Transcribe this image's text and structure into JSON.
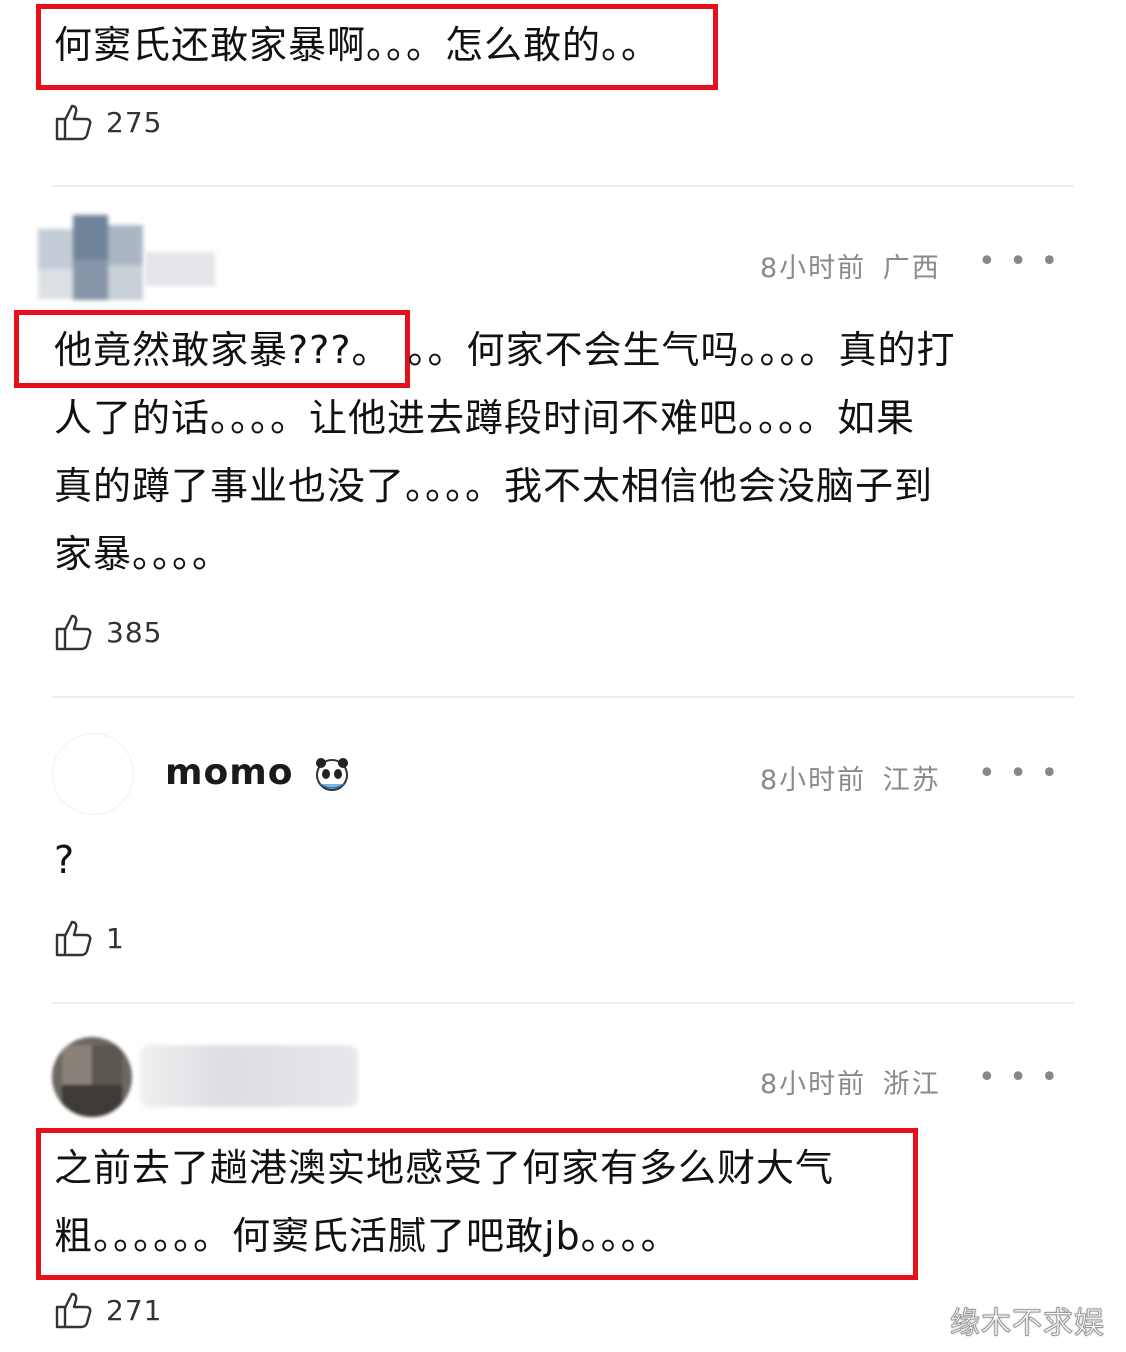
{
  "comments": [
    {
      "text": "何窦氏还敢家暴啊。。。怎么敢的。。",
      "likes": "275"
    },
    {
      "time": "8小时前",
      "location": "广西",
      "highlighted": "他竟然敢家暴???。",
      "text_rest": "。。何家不会生气吗。。。。真的打",
      "text_line2": "人了的话。。。。让他进去蹲段时间不难吧。。。。如果",
      "text_line3": "真的蹲了事业也没了。。。。我不太相信他会没脑子到",
      "text_line4": "家暴。。。。",
      "likes": "385"
    },
    {
      "username": "momo",
      "time": "8小时前",
      "location": "江苏",
      "text": "?",
      "likes": "1"
    },
    {
      "time": "8小时前",
      "location": "浙江",
      "text_line1": "之前去了趟港澳实地感受了何家有多么财大气",
      "text_line2": "粗。。。。。。何窦氏活腻了吧敢jb。。。。",
      "likes": "271"
    }
  ],
  "more_symbol": "• • •",
  "watermark": "缘木不求娱",
  "colors": {
    "highlight_border": "#e5101a",
    "meta": "#8a8a8a"
  }
}
